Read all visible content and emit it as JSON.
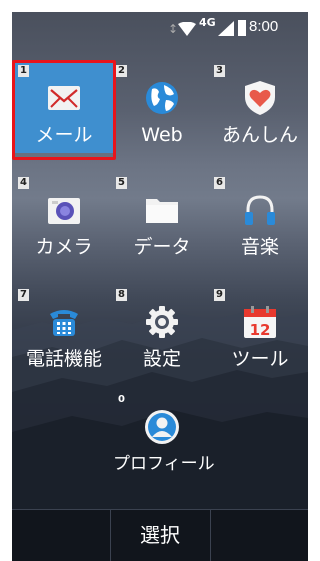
{
  "status": {
    "network": "4G",
    "time": "8:00"
  },
  "apps": [
    {
      "num": "1",
      "label": "メール",
      "icon": "mail-icon",
      "selected": true
    },
    {
      "num": "2",
      "label": "Web",
      "icon": "globe-icon"
    },
    {
      "num": "3",
      "label": "あんしん",
      "icon": "shield-heart-icon"
    },
    {
      "num": "4",
      "label": "カメラ",
      "icon": "camera-icon"
    },
    {
      "num": "5",
      "label": "データ",
      "icon": "folder-icon"
    },
    {
      "num": "6",
      "label": "音楽",
      "icon": "headphones-icon"
    },
    {
      "num": "7",
      "label": "電話機能",
      "icon": "phone-icon"
    },
    {
      "num": "8",
      "label": "設定",
      "icon": "gear-icon"
    },
    {
      "num": "9",
      "label": "ツール",
      "icon": "calendar-icon"
    },
    {
      "num": "0",
      "label": "プロフィール",
      "icon": "profile-icon"
    }
  ],
  "calendar_day": "12",
  "softkey": {
    "center": "選択"
  },
  "colors": {
    "selected": "#3f8fcf",
    "highlight_border": "#e8141b",
    "shield": "#e8594a",
    "calendar_red": "#e8392e"
  }
}
